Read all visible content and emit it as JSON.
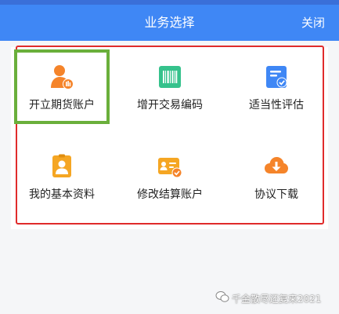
{
  "header": {
    "title": "业务选择",
    "close_label": "关闭"
  },
  "grid": {
    "items": [
      {
        "label": "开立期货账户",
        "icon": "user-account-icon"
      },
      {
        "label": "增开交易编码",
        "icon": "barcode-icon"
      },
      {
        "label": "适当性评估",
        "icon": "assessment-clipboard-icon"
      },
      {
        "label": "我的基本资料",
        "icon": "profile-badge-icon"
      },
      {
        "label": "修改结算账户",
        "icon": "bank-card-edit-icon"
      },
      {
        "label": "协议下载",
        "icon": "cloud-download-icon"
      }
    ]
  },
  "watermark": {
    "text": "千金散尽还复来2021"
  },
  "colors": {
    "header_blue": "#3f87f5",
    "icon_orange": "#f5842a",
    "icon_green": "#35c28c",
    "icon_blue": "#3f87f5",
    "highlight_red": "#e02b2b",
    "highlight_green": "#6aaf3b"
  }
}
